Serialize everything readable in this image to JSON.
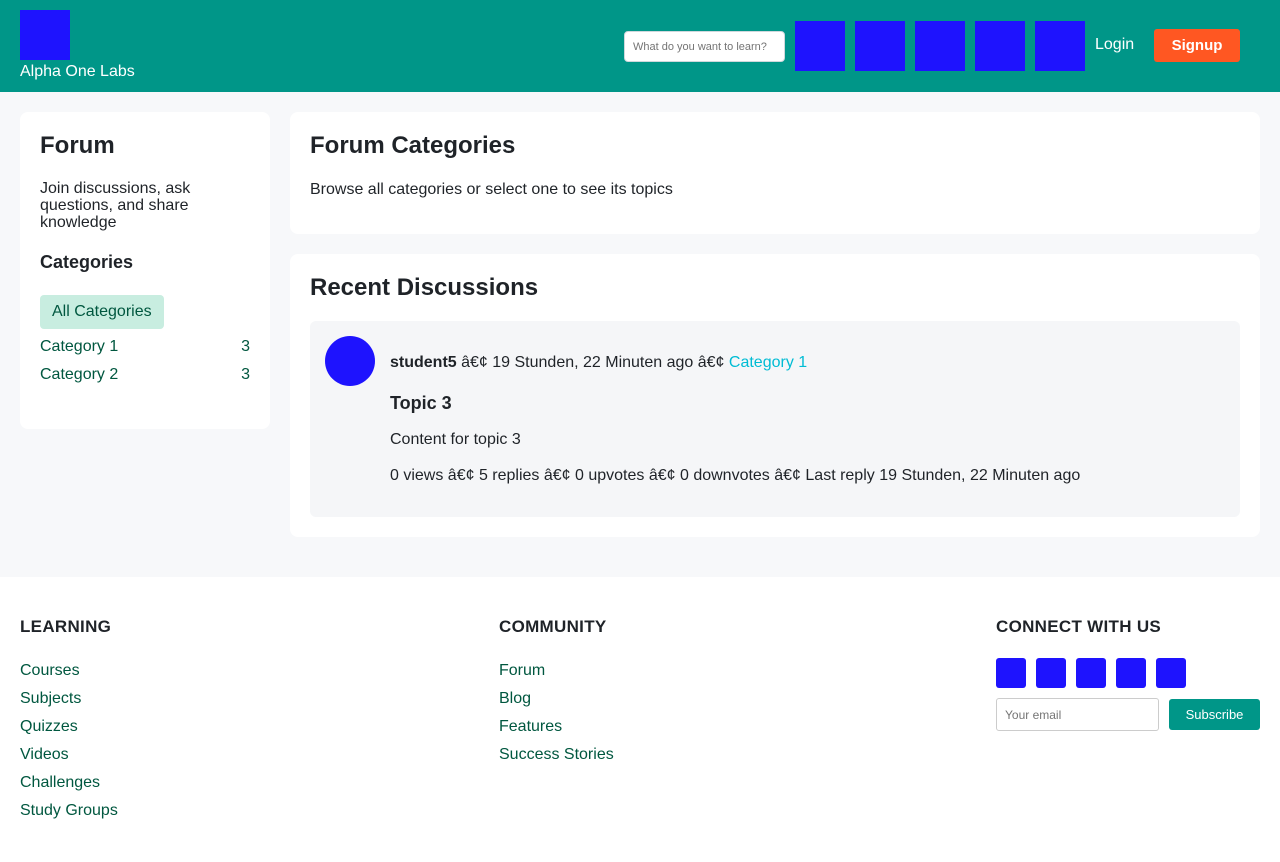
{
  "header": {
    "brand": "Alpha One Labs",
    "search_placeholder": "What do you want to learn?",
    "nav_icons": [
      "nav-icon-1",
      "nav-icon-2",
      "nav-icon-3",
      "nav-icon-4",
      "nav-icon-5"
    ],
    "login_label": "Login",
    "signup_label": "Signup"
  },
  "sidebar": {
    "title": "Forum",
    "description": "Join discussions, ask questions, and share knowledge",
    "categories_heading": "Categories",
    "all_categories_label": "All Categories",
    "categories": [
      {
        "name": "Category 1",
        "count": "3"
      },
      {
        "name": "Category 2",
        "count": "3"
      }
    ]
  },
  "categories_card": {
    "title": "Forum Categories",
    "subtitle": "Browse all categories or select one to see its topics"
  },
  "recent": {
    "title": "Recent Discussions",
    "discussion": {
      "author": "student5",
      "sep1": " â€¢ ",
      "time": "19 Stunden, 22 Minuten ago",
      "sep2": " â€¢ ",
      "category": "Category 1",
      "topic_title": "Topic 3",
      "content": "Content for topic 3",
      "stats": "0 views â€¢ 5 replies â€¢ 0 upvotes â€¢ 0 downvotes â€¢ Last reply 19 Stunden, 22 Minuten ago"
    }
  },
  "footer": {
    "learning": {
      "heading": "LEARNING",
      "links": [
        "Courses",
        "Subjects",
        "Quizzes",
        "Videos",
        "Challenges",
        "Study Groups"
      ]
    },
    "community": {
      "heading": "COMMUNITY",
      "links": [
        "Forum",
        "Blog",
        "Features",
        "Success Stories"
      ]
    },
    "connect": {
      "heading": "CONNECT WITH US",
      "email_placeholder": "Your email",
      "subscribe_label": "Subscribe"
    }
  },
  "colors": {
    "header_bg": "#009688",
    "accent": "#ff5722",
    "icon_placeholder": "#1e13fe",
    "link": "#00573f",
    "category_link": "#00bcd4"
  }
}
